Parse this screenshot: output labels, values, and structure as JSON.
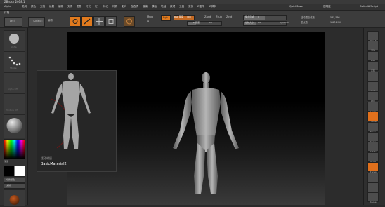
{
  "titlebar": {
    "title": "ZBrush 2018.1"
  },
  "menubar": {
    "items": [
      "Alpha",
      "笔刷",
      "颜色",
      "文档",
      "绘制",
      "编辑",
      "文件",
      "图层",
      "灯光",
      "宏",
      "标记",
      "材质",
      "影片",
      "首选项",
      "渲染",
      "模板",
      "笔触",
      "纹理",
      "工具",
      "变换",
      "Z插件",
      "Z脚本"
    ],
    "quicksave": "QuickSave",
    "transparency": "透明度",
    "default_script": "DefaultZScript"
  },
  "shelf": {
    "light_box": "灯箱",
    "projection_master": "投射",
    "live_boolean": "实时布尔",
    "draw_modes": [
      "编辑",
      "绘制"
    ],
    "mrgb": "Mrgb",
    "rgb_label": "Rgb",
    "m_label": "M",
    "zadd": "Zadd",
    "zsub": "Zsub",
    "zcut": "Zcut",
    "rgb_intensity_label": "Rgb 强度",
    "rgb_intensity_value": "100",
    "z_intensity_label": "Z 强度",
    "z_intensity_value": "25",
    "focal_shift_label": "焦点衰减",
    "focal_shift_value": "0",
    "draw_size_label": "绘制大小",
    "draw_size_value": "64",
    "dynamic": "Dynamic",
    "active_points_label": "活动顶点总数:",
    "active_points_value": "535,566",
    "total_points_label": "总点数:",
    "total_points_value": "1.074 Mil"
  },
  "left_panel": {
    "slots": [
      "Alpha",
      "Stroke",
      "Alpha Off",
      "Texture Off",
      "Material"
    ],
    "gradient_label": "渐变",
    "switch_color": "切换颜色",
    "alternate": "交替"
  },
  "popup": {
    "label": "BasicMaterial2",
    "sublabel": "活动材质"
  },
  "right_panel": {
    "buttons": [
      "SPix 3",
      "滚动",
      "缩放",
      "实际",
      "AAHalf",
      "透视",
      "地面",
      "Lsym",
      "Frame",
      "Move",
      "Scale",
      "Rotate",
      "PolyF",
      "Transp",
      "Ghost",
      "Solo",
      "Xpose"
    ]
  }
}
